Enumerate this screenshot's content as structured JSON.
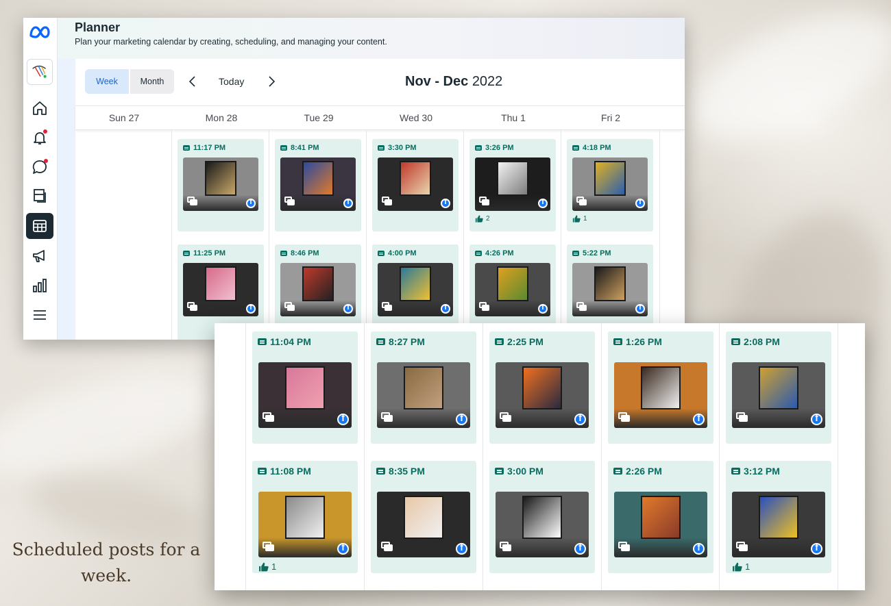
{
  "app": {
    "title": "Planner",
    "subtitle": "Plan your marketing calendar by creating, scheduling, and managing your content."
  },
  "sidebar": {
    "logo": "meta-logo-icon",
    "items": [
      {
        "name": "home",
        "icon": "home-icon",
        "active": false
      },
      {
        "name": "notifications",
        "icon": "bell-icon",
        "active": false,
        "badge": true
      },
      {
        "name": "inbox",
        "icon": "chat-icon",
        "active": false,
        "badge": true
      },
      {
        "name": "content",
        "icon": "content-icon",
        "active": false
      },
      {
        "name": "planner",
        "icon": "calendar-grid-icon",
        "active": true
      },
      {
        "name": "ads",
        "icon": "megaphone-icon",
        "active": false
      },
      {
        "name": "insights",
        "icon": "bar-chart-icon",
        "active": false
      },
      {
        "name": "menu",
        "icon": "menu-icon",
        "active": false
      }
    ]
  },
  "toolbar": {
    "week_label": "Week",
    "month_label": "Month",
    "today_label": "Today",
    "range_bold": "Nov - Dec",
    "range_year": "2022"
  },
  "days": [
    "Sun 27",
    "Mon 28",
    "Tue 29",
    "Wed 30",
    "Thu 1",
    "Fri 2"
  ],
  "back_posts": {
    "row1": [
      {
        "time": "11:17 PM",
        "likes": ""
      },
      {
        "time": "8:41 PM",
        "likes": ""
      },
      {
        "time": "3:30 PM",
        "likes": ""
      },
      {
        "time": "3:26 PM",
        "likes": "2"
      },
      {
        "time": "4:18 PM",
        "likes": "1"
      }
    ],
    "row2": [
      {
        "time": "11:25 PM"
      },
      {
        "time": "8:46 PM"
      },
      {
        "time": "4:00 PM"
      },
      {
        "time": "4:26 PM"
      },
      {
        "time": "5:22 PM"
      }
    ]
  },
  "front_posts": {
    "row1": [
      {
        "time": "11:04 PM",
        "likes": ""
      },
      {
        "time": "8:27 PM",
        "likes": ""
      },
      {
        "time": "2:25 PM",
        "likes": ""
      },
      {
        "time": "1:26 PM",
        "likes": ""
      },
      {
        "time": "2:08 PM",
        "likes": ""
      }
    ],
    "row2": [
      {
        "time": "11:08 PM",
        "likes": "1"
      },
      {
        "time": "8:35 PM",
        "likes": ""
      },
      {
        "time": "3:00 PM",
        "likes": ""
      },
      {
        "time": "2:26 PM",
        "likes": ""
      },
      {
        "time": "3:12 PM",
        "likes": "1"
      }
    ]
  },
  "caption": {
    "line1": "Scheduled posts for a",
    "line2": "week."
  },
  "colors": {
    "accent": "#1a66c7",
    "post_bg": "#e1f2ee",
    "post_text": "#0a6b5f",
    "facebook": "#1877f2",
    "sidebar_active": "#1c2b33"
  }
}
